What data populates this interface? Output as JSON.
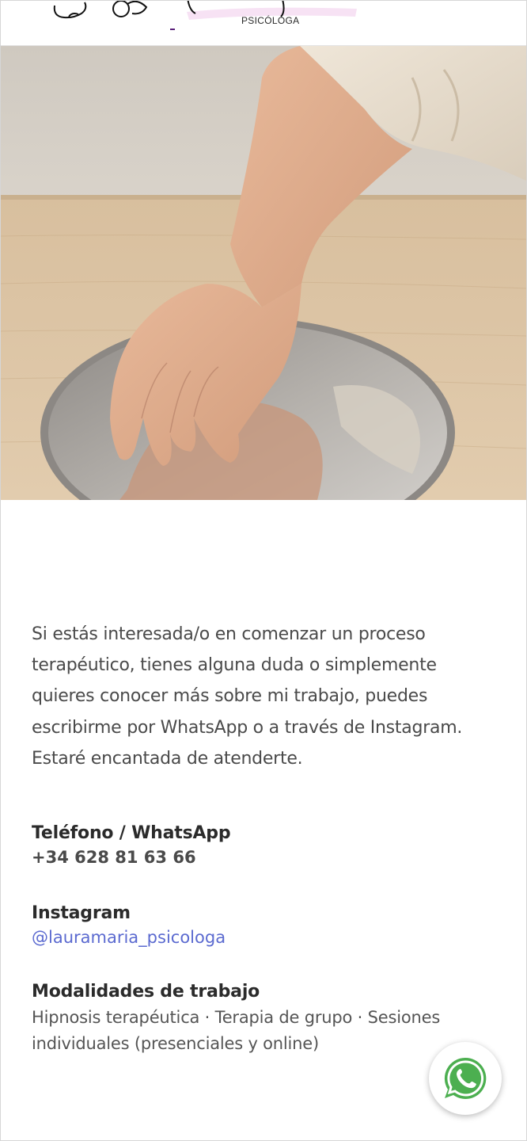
{
  "header": {
    "logo_subtitle": "PSICÓLOGA"
  },
  "hero": {
    "image_name": "hand-reflection-mirror-photo"
  },
  "content": {
    "intro": "Si estás interesada/o en comenzar un proceso terapéutico, tienes alguna duda o simplemente quieres conocer más sobre mi trabajo, puedes escribirme por WhatsApp o a través de Instagram. Estaré encantada de atenderte.",
    "phone_title": "Teléfono / WhatsApp",
    "phone_value": "+34 628 81 63 66",
    "instagram_title": "Instagram",
    "instagram_handle": "@lauramaria_psicologa",
    "modalities_title": "Modalidades de trabajo",
    "modalities_text": "Hipnosis terapéutica · Terapia de grupo · Sesiones individuales (presenciales y online)"
  },
  "floating_button": {
    "icon": "whatsapp-icon",
    "color": "#4caf50"
  },
  "colors": {
    "link": "#5b6ad0",
    "text": "#4a4a4a",
    "heading": "#2b2b2b",
    "logo_accent": "#5a1f7a"
  }
}
